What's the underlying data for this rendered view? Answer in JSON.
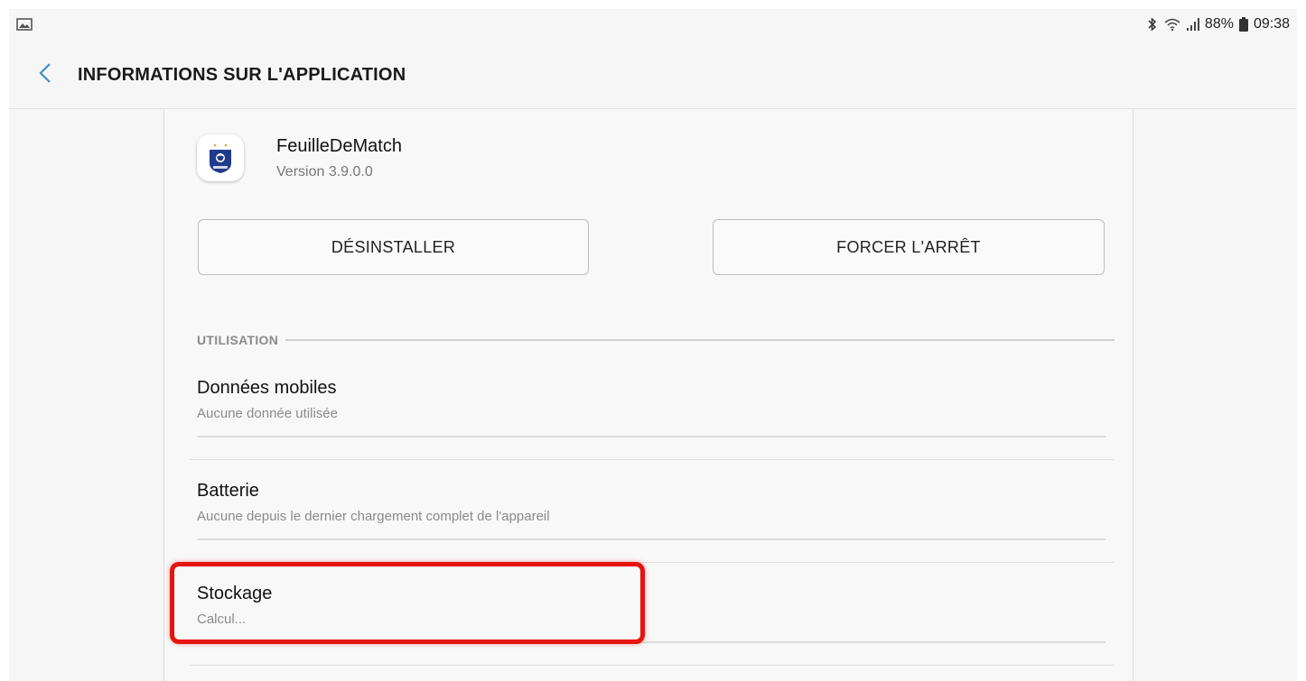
{
  "status_bar": {
    "left_icon": "image-notification-icon",
    "bluetooth_icon": "bluetooth-icon",
    "wifi_icon": "wifi-icon",
    "signal_icon": "signal-icon",
    "battery_percent": "88%",
    "battery_icon": "battery-icon",
    "time": "09:38"
  },
  "header": {
    "back_icon": "chevron-left-icon",
    "title": "INFORMATIONS SUR L'APPLICATION"
  },
  "app": {
    "icon": "fff-logo-icon",
    "name": "FeuilleDeMatch",
    "version": "Version 3.9.0.0"
  },
  "buttons": {
    "uninstall": "DÉSINSTALLER",
    "force_stop": "FORCER L'ARRÊT"
  },
  "section": {
    "label": "UTILISATION"
  },
  "items": [
    {
      "name": "Données mobiles",
      "sub": "Aucune donnée utilisée"
    },
    {
      "name": "Batterie",
      "sub": "Aucune depuis le dernier chargement complet de l'appareil"
    },
    {
      "name": "Stockage",
      "sub": "Calcul..."
    }
  ],
  "colors": {
    "accent_back": "#3f8fc9",
    "highlight": "#e4150d",
    "logo_blue": "#1f3b8c"
  }
}
